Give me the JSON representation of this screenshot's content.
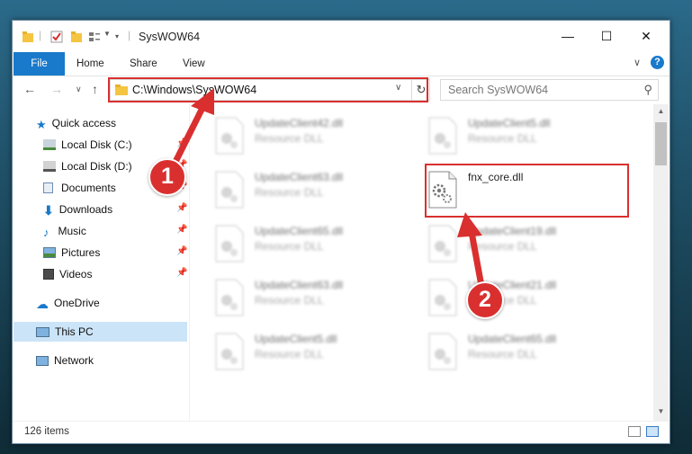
{
  "window": {
    "title": "SysWOW64"
  },
  "ribbon": {
    "tabs": [
      "File",
      "Home",
      "Share",
      "View"
    ]
  },
  "address": {
    "path": "C:\\Windows\\SysWOW64"
  },
  "search": {
    "placeholder": "Search SysWOW64"
  },
  "sidebar": {
    "items": [
      {
        "label": "Quick access",
        "icon": "star-icon",
        "pinned": false
      },
      {
        "label": "Local Disk (C:)",
        "icon": "drive-icon",
        "pinned": true
      },
      {
        "label": "Local Disk (D:)",
        "icon": "drive-icon",
        "pinned": true
      },
      {
        "label": "Documents",
        "icon": "documents-icon",
        "pinned": true
      },
      {
        "label": "Downloads",
        "icon": "download-icon",
        "pinned": true
      },
      {
        "label": "Music",
        "icon": "music-icon",
        "pinned": true
      },
      {
        "label": "Pictures",
        "icon": "pictures-icon",
        "pinned": true
      },
      {
        "label": "Videos",
        "icon": "videos-icon",
        "pinned": true
      },
      {
        "label": "OneDrive",
        "icon": "cloud-icon",
        "pinned": false
      },
      {
        "label": "This PC",
        "icon": "pc-icon",
        "pinned": false,
        "selected": true
      },
      {
        "label": "Network",
        "icon": "network-icon",
        "pinned": false
      }
    ]
  },
  "files": [
    {
      "name": "UpdateClient42.dll",
      "desc": "Resource DLL"
    },
    {
      "name": "UpdateClient5.dll",
      "desc": "Resource DLL"
    },
    {
      "name": "UpdateClient63.dll",
      "desc": "Resource DLL"
    },
    {
      "name": "fnx_core.dll",
      "desc": ""
    },
    {
      "name": "UpdateClient65.dll",
      "desc": "Resource DLL"
    },
    {
      "name": "UpdateClient19.dll",
      "desc": "Resource DLL"
    },
    {
      "name": "UpdateClient63.dll",
      "desc": "Resource DLL"
    },
    {
      "name": "UpdateClient21.dll",
      "desc": "Resource DLL"
    },
    {
      "name": "UpdateClient5.dll",
      "desc": "Resource DLL"
    },
    {
      "name": "UpdateClient65.dll",
      "desc": "Resource DLL"
    }
  ],
  "status": {
    "count": "126 items"
  },
  "annotations": {
    "step1": "1",
    "step2": "2",
    "color": "#d9302f"
  }
}
